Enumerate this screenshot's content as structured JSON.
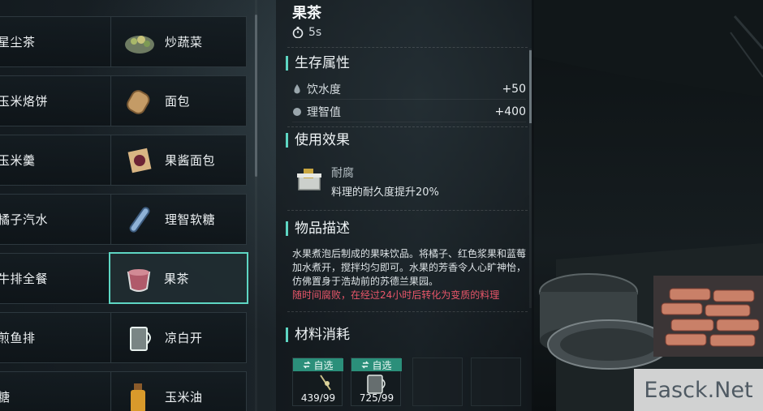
{
  "recipes": [
    {
      "left": "星尘茶",
      "right": "炒蔬菜"
    },
    {
      "left": "玉米烙饼",
      "right": "面包"
    },
    {
      "left": "玉米羹",
      "right": "果酱面包"
    },
    {
      "left": "橘子汽水",
      "right": "理智软糖"
    },
    {
      "left": "牛排全餐",
      "right": "果茶"
    },
    {
      "left": "煎鱼排",
      "right": "凉白开"
    },
    {
      "left": "糖",
      "right": "玉米油"
    }
  ],
  "selected_recipe": "果茶",
  "detail": {
    "title": "果茶",
    "time": "5s",
    "survival_header": "生存属性",
    "stats": [
      {
        "label": "饮水度",
        "value": "+50",
        "icon": "water-drop-icon"
      },
      {
        "label": "理智值",
        "value": "+400",
        "icon": "brain-icon"
      }
    ],
    "effect_header": "使用效果",
    "effect_name": "耐腐",
    "effect_desc": "料理的耐久度提升20%",
    "desc_header": "物品描述",
    "description": "水果煮泡后制成的果味饮品。将橘子、红色浆果和蓝莓加水煮开，搅拌均匀即可。水果的芳香令人心旷神怡，仿佛置身于浩劫前的苏德兰果园。",
    "warning": "随时间腐败，在经过24小时后转化为变质的料理",
    "materials_header": "材料消耗",
    "materials": [
      {
        "tag": "自选",
        "qty": "439/99"
      },
      {
        "tag": "自选",
        "qty": "725/99"
      }
    ]
  },
  "watermark": "Easck.Net",
  "colors": {
    "accent": "#5ed6c3",
    "tag": "#2b8f7a",
    "warning": "#e9566a"
  }
}
